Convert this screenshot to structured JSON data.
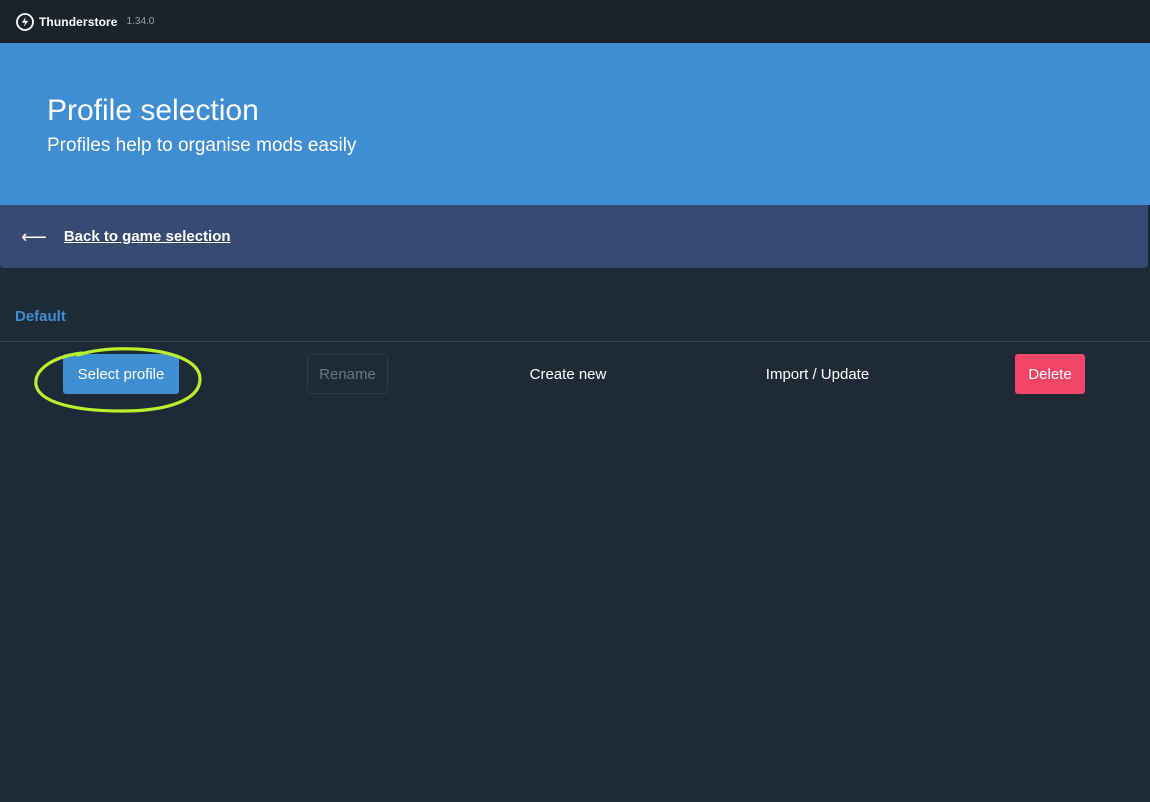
{
  "titlebar": {
    "app_name": "Thunderstore",
    "version": "1.34.0",
    "logo_icon": "thunderstore-logo-icon"
  },
  "hero": {
    "title": "Profile selection",
    "subtitle": "Profiles help to organise mods easily",
    "background": "#3f8ed3"
  },
  "back": {
    "icon": "arrow-left-icon",
    "label": "Back to game selection"
  },
  "profiles": {
    "selected_name": "Default"
  },
  "actions": {
    "select_label": "Select profile",
    "rename_label": "Rename",
    "create_label": "Create new",
    "import_label": "Import / Update",
    "delete_label": "Delete"
  },
  "colors": {
    "accent": "#3f8ed3",
    "danger": "#f14668",
    "background": "#1f2a37",
    "annotation": "#b8f02c"
  }
}
